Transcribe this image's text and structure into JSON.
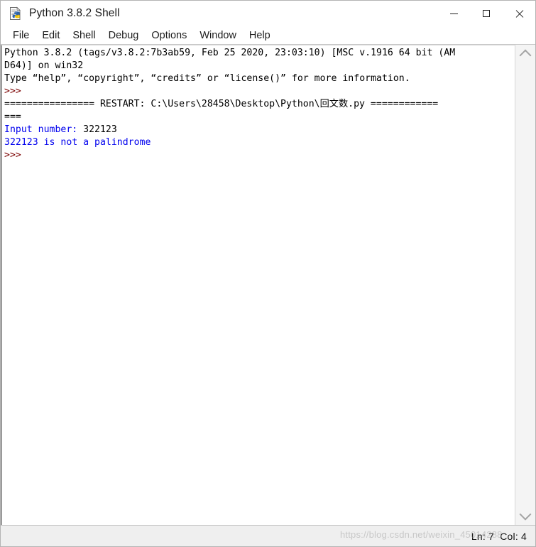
{
  "window": {
    "title": "Python 3.8.2 Shell",
    "icon": "idle-python-icon",
    "controls": {
      "minimize": "minimize-icon",
      "maximize": "maximize-icon",
      "close": "close-icon"
    }
  },
  "menubar": {
    "items": [
      {
        "label": "File"
      },
      {
        "label": "Edit"
      },
      {
        "label": "Shell"
      },
      {
        "label": "Debug"
      },
      {
        "label": "Options"
      },
      {
        "label": "Window"
      },
      {
        "label": "Help"
      }
    ]
  },
  "console": {
    "lines": [
      {
        "segments": [
          {
            "text": "Python 3.8.2 (tags/v3.8.2:7b3ab59, Feb 25 2020, 23:03:10) [MSC v.1916 64 bit (AM",
            "style": "black"
          }
        ]
      },
      {
        "segments": [
          {
            "text": "D64)] on win32",
            "style": "black"
          }
        ]
      },
      {
        "segments": [
          {
            "text": "Type “help”, “copyright”, “credits” or “license()” for more information.",
            "style": "black"
          }
        ]
      },
      {
        "segments": [
          {
            "text": ">>>",
            "style": "prompt"
          }
        ]
      },
      {
        "segments": [
          {
            "text": "================ RESTART: C:\\Users\\28458\\Desktop\\Python\\回文数.py ============",
            "style": "black"
          }
        ]
      },
      {
        "segments": [
          {
            "text": "===",
            "style": "black"
          }
        ]
      },
      {
        "segments": [
          {
            "text": "Input number:",
            "style": "stdout"
          },
          {
            "text": " 322123",
            "style": "black"
          }
        ]
      },
      {
        "segments": [
          {
            "text": "322123 is not a palindrome",
            "style": "stdout"
          }
        ]
      },
      {
        "segments": [
          {
            "text": ">>>",
            "style": "prompt"
          }
        ]
      }
    ],
    "colors": {
      "prompt": "#7b0000",
      "stdout": "#0000ee",
      "stdin": "#000000",
      "background": "#ffffff"
    }
  },
  "scrollbar": {
    "up_arrow": "chevron-up-icon",
    "down_arrow": "chevron-down-icon"
  },
  "statusbar": {
    "position": "Ln: 7  Col: 4"
  },
  "watermark": {
    "text": "https://blog.csdn.net/weixin_45014288"
  }
}
